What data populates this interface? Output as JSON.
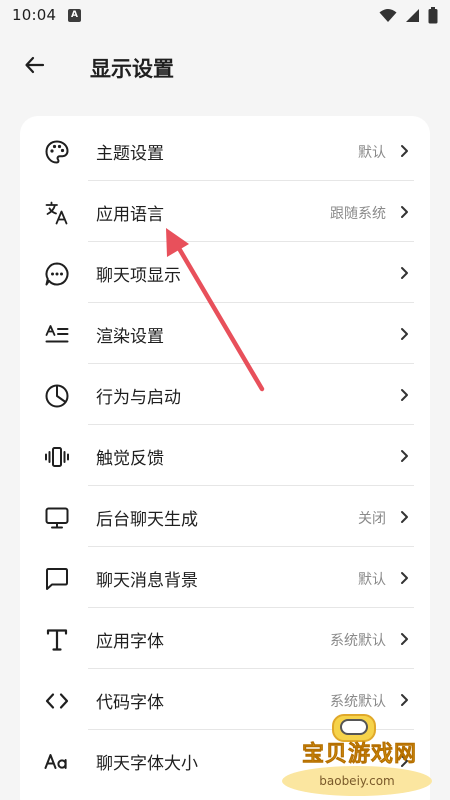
{
  "status_bar": {
    "time": "10:04",
    "notification_badge": "A"
  },
  "header": {
    "title": "显示设置",
    "back_icon": "arrow-left-icon"
  },
  "settings": [
    {
      "id": "theme",
      "icon": "palette-icon",
      "label": "主题设置",
      "value": "默认"
    },
    {
      "id": "app-language",
      "icon": "translate-icon",
      "label": "应用语言",
      "value": "跟随系统"
    },
    {
      "id": "chat-item-display",
      "icon": "chat-bubble-dots-icon",
      "label": "聊天项显示",
      "value": ""
    },
    {
      "id": "render",
      "icon": "render-lines-icon",
      "label": "渲染设置",
      "value": ""
    },
    {
      "id": "behavior-startup",
      "icon": "pie-clock-icon",
      "label": "行为与启动",
      "value": ""
    },
    {
      "id": "haptics",
      "icon": "vibration-icon",
      "label": "触觉反馈",
      "value": ""
    },
    {
      "id": "background-chat",
      "icon": "monitor-icon",
      "label": "后台聊天生成",
      "value": "关闭"
    },
    {
      "id": "chat-background",
      "icon": "message-square-icon",
      "label": "聊天消息背景",
      "value": "默认"
    },
    {
      "id": "app-font",
      "icon": "text-t-icon",
      "label": "应用字体",
      "value": "系统默认"
    },
    {
      "id": "code-font",
      "icon": "code-brackets-icon",
      "label": "代码字体",
      "value": "系统默认"
    },
    {
      "id": "chat-font-size",
      "icon": "font-size-aa-icon",
      "label": "聊天字体大小",
      "value": ""
    }
  ],
  "watermark": {
    "title": "宝贝游戏网",
    "url": "baobeiy.com"
  },
  "colors": {
    "background": "#f5f5f5",
    "card": "#ffffff",
    "annotation_arrow": "#e8505b",
    "secondary_text": "#8a8a8a"
  }
}
